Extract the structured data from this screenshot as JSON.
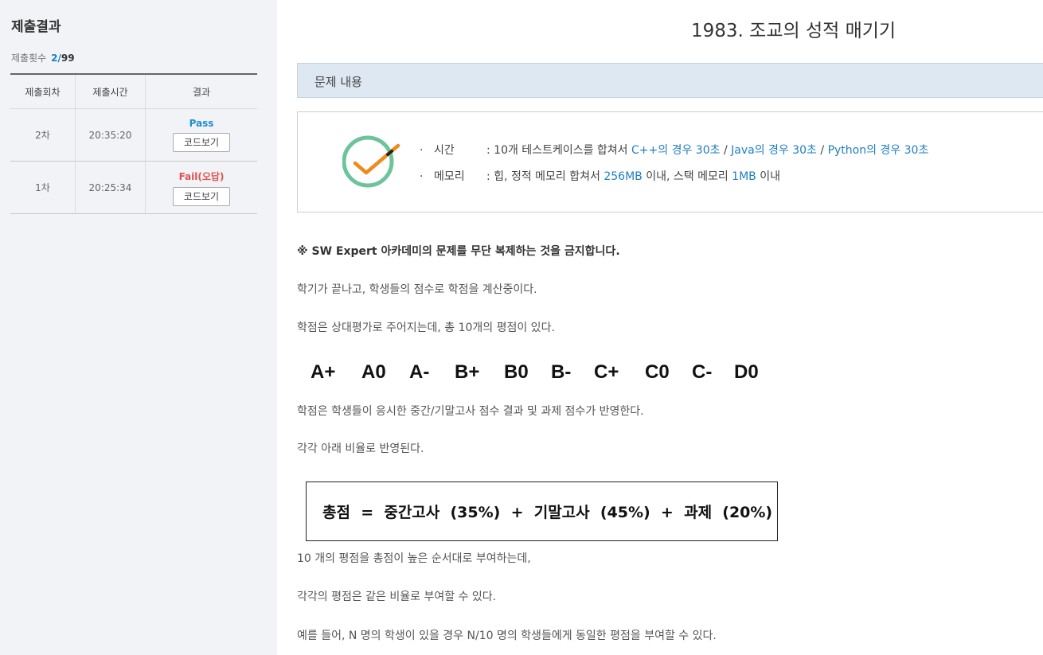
{
  "sidebar": {
    "title": "제출결과",
    "count_label": "제출횟수",
    "count_value": "2",
    "count_sep": "/",
    "count_total": "99",
    "table": {
      "headers": [
        "제출회차",
        "제출시간",
        "결과"
      ],
      "rows": [
        {
          "round": "2차",
          "time": "20:35:20",
          "result": "Pass",
          "status": "pass",
          "button": "코드보기"
        },
        {
          "round": "1차",
          "time": "20:25:34",
          "result": "Fail(오답)",
          "status": "fail",
          "button": "코드보기"
        }
      ]
    }
  },
  "problem": {
    "title": "1983. 조교의 성적 매기기",
    "section_header": "문제 내용",
    "limits": {
      "time_label": "시간",
      "time_prefix": ": 10개 테스트케이스를 합쳐서",
      "time_cpp": "C++의 경우 30초",
      "time_java": "Java의 경우 30초",
      "time_python": "Python의 경우 30초",
      "time_sep": "/",
      "memory_label": "메모리",
      "memory_prefix": ": 힙, 정적 메모리 합쳐서",
      "memory_heap": "256MB",
      "memory_mid": "이내, 스택 메모리",
      "memory_stack": "1MB",
      "memory_suffix": "이내"
    },
    "notice": "※ SW Expert 아카데미의 문제를 무단 복제하는 것을 금지합니다.",
    "para1": "학기가 끝나고, 학생들의 점수로 학점을 계산중이다.",
    "para2": "학점은 상대평가로 주어지는데, 총 10개의 평점이 있다.",
    "grades": [
      "A+",
      "A0",
      "A-",
      "B+",
      "B0",
      "B-",
      "C+",
      "C0",
      "C-",
      "D0"
    ],
    "para3": "학점은 학생들이 응시한 중간/기말고사 점수 결과 및 과제 점수가 반영한다.",
    "para4": "각각 아래 비율로 반영된다.",
    "formula": "총점  =  중간고사  (35%)  +  기말고사  (45%)  +  과제  (20%)",
    "para5": "10 개의 평점을 총점이 높은 순서대로 부여하는데,",
    "para6": "각각의 평점은 같은 비율로 부여할 수 있다.",
    "para7": "예를 들어, N 명의 학생이 있을 경우 N/10 명의 학생들에게 동일한 평점을 부여할 수 있다."
  },
  "colors": {
    "sidebar_bg": "#f1f3f6",
    "link_blue": "#1e7fc1",
    "pass": "#1e8fd3",
    "fail": "#e05252",
    "header_bg": "#dee8f2",
    "check_circle": "#6cc49a",
    "check_mark": "#f08a1c"
  },
  "icons": {
    "limits": "check-icon"
  }
}
